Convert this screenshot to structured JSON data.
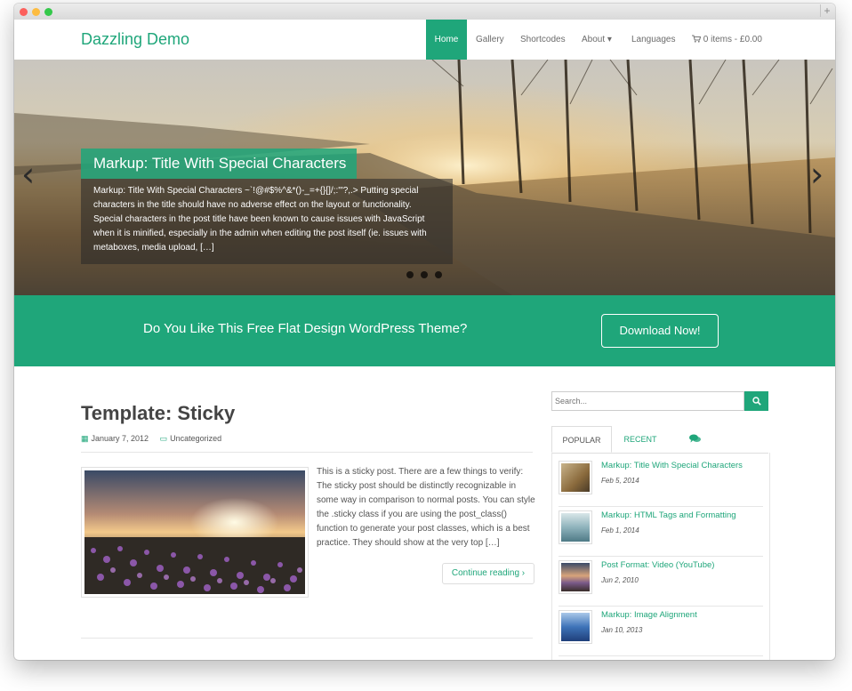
{
  "nav": {
    "brand": "Dazzling Demo",
    "items": [
      "Home",
      "Gallery",
      "Shortcodes",
      "About ▾",
      "Languages",
      "0 items - £0.00"
    ]
  },
  "slider": {
    "title": "Markup: Title With Special Characters",
    "description": "Markup: Title With Special Characters ~`!@#$%^&*()-_=+{}[]/;:'\"?,.> Putting special characters in the title should have no adverse effect on the layout or functionality. Special characters in the post title have been known to cause issues with JavaScript when it is minified, especially in the admin when editing the post itself (ie. issues with metaboxes, media upload, […]"
  },
  "cta": {
    "text": "Do You Like This Free Flat Design WordPress Theme?",
    "button": "Download Now!"
  },
  "post": {
    "title": "Template: Sticky",
    "date": "January 7, 2012",
    "category": "Uncategorized",
    "excerpt": "This is a sticky post. There are a few things to verify: The sticky post should be distinctly recognizable in some way in comparison to normal posts. You can style the .sticky class if you are using the post_class() function to generate your post classes, which is a best practice. They should show at the very top […]",
    "continue": "Continue reading"
  },
  "sidebar": {
    "search_placeholder": "Search...",
    "tabs": [
      "POPULAR",
      "RECENT"
    ],
    "popular": [
      {
        "title": "Markup: Title With Special Characters",
        "date": "Feb 5, 2014"
      },
      {
        "title": "Markup: HTML Tags and Formatting",
        "date": "Feb 1, 2014"
      },
      {
        "title": "Post Format: Video (YouTube)",
        "date": "Jun 2, 2010"
      },
      {
        "title": "Markup: Image Alignment",
        "date": "Jan 10, 2013"
      }
    ]
  },
  "colors": {
    "accent": "#1fa67a"
  }
}
